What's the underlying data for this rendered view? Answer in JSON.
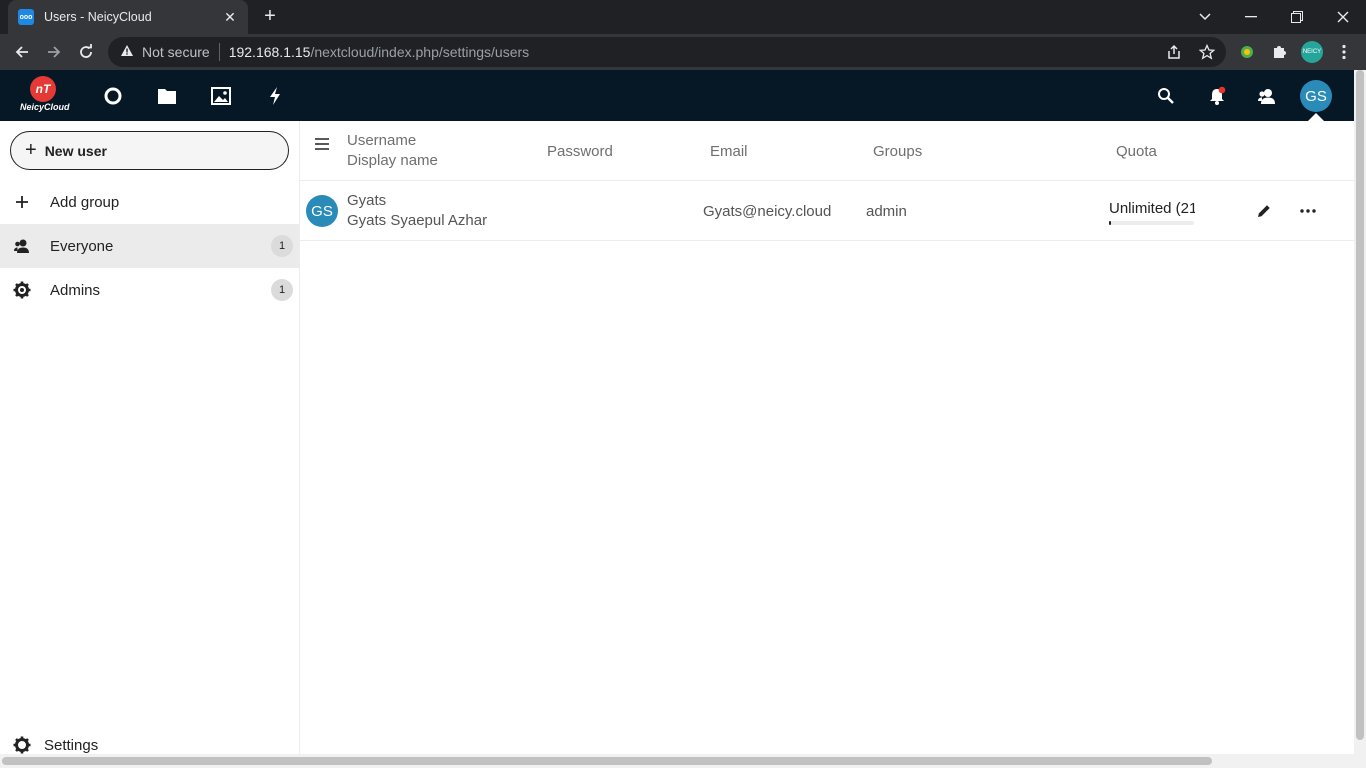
{
  "browser": {
    "tab_title": "Users - NeicyCloud",
    "favicon_text": "ooo",
    "security_label": "Not secure",
    "url_host": "192.168.1.15",
    "url_path": "/nextcloud/index.php/settings/users",
    "profile_chip_text": "NEICY"
  },
  "header": {
    "logo_mark": "nT",
    "logo_text": "NeicyCloud",
    "avatar_initials": "GS",
    "apps": [
      "dashboard-icon",
      "files-icon",
      "photos-icon",
      "activity-icon"
    ],
    "right_icons": [
      "search-icon",
      "notifications-icon",
      "contacts-icon"
    ],
    "accent_color": "#061726",
    "avatar_color": "#2a8bb8",
    "notification_dot_color": "#e9322d"
  },
  "sidebar": {
    "new_user_label": "New user",
    "add_group_label": "Add group",
    "groups": [
      {
        "label": "Everyone",
        "count": "1",
        "icon": "users-icon",
        "active": true
      },
      {
        "label": "Admins",
        "count": "1",
        "icon": "admin-gear-icon",
        "active": false
      }
    ],
    "settings_label": "Settings"
  },
  "table": {
    "columns": {
      "username": "Username",
      "display_name": "Display name",
      "password": "Password",
      "email": "Email",
      "groups": "Groups",
      "quota": "Quota"
    },
    "rows": [
      {
        "avatar": "GS",
        "username": "Gyats",
        "display_name": "Gyats Syaepul Azhar",
        "email": "Gyats@neicy.cloud",
        "groups": "admin",
        "quota": "Unlimited (21",
        "quota_fraction": 0.02
      }
    ]
  }
}
